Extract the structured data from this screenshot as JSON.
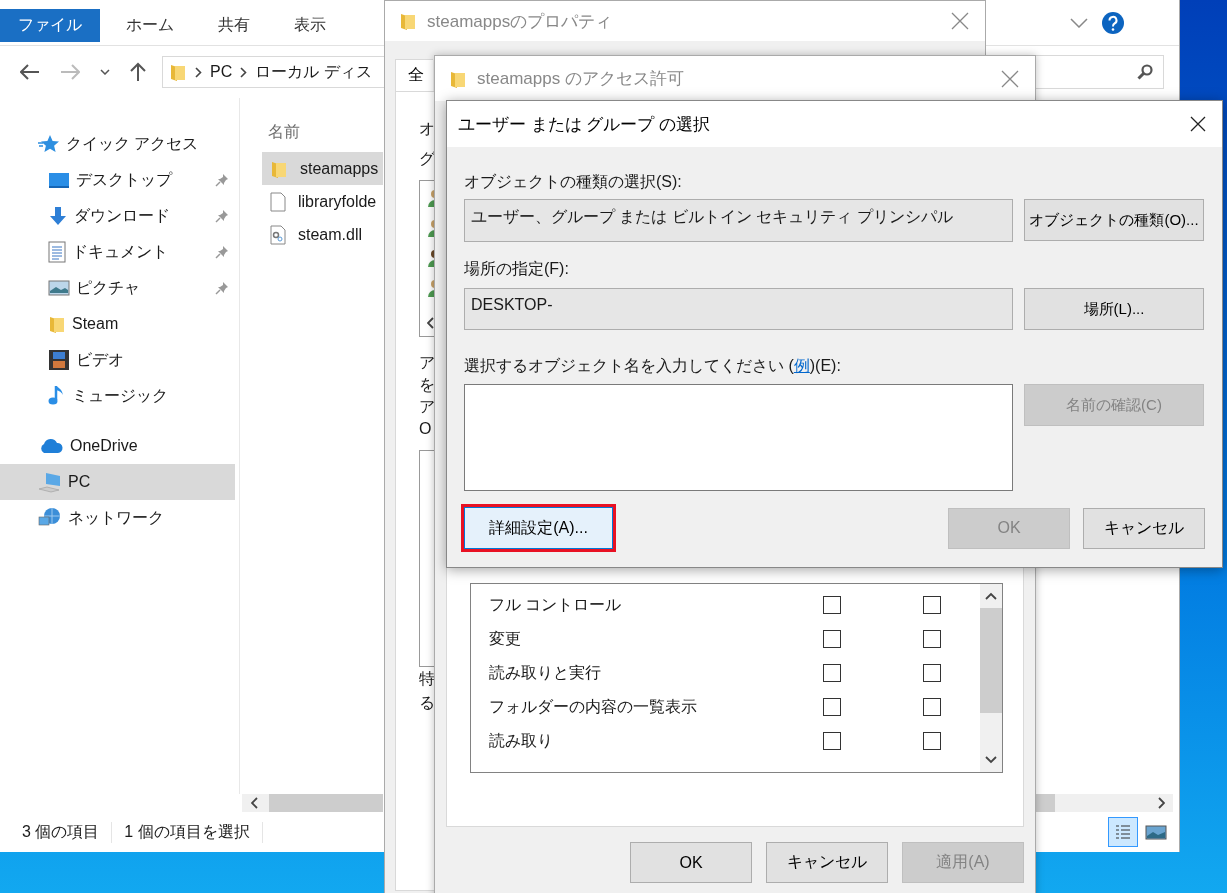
{
  "explorer": {
    "ribbon_tabs": [
      {
        "label": "ファイル",
        "selected": true
      },
      {
        "label": "ホーム",
        "selected": false
      },
      {
        "label": "共有",
        "selected": false
      },
      {
        "label": "表示",
        "selected": false
      }
    ],
    "address": [
      "PC",
      "ローカル ディス"
    ],
    "nav": [
      {
        "label": "クイック アクセス",
        "kind": "star",
        "selected": false,
        "children": [
          {
            "label": "デスクトップ",
            "kind": "desktop",
            "pinned": true,
            "selected": false
          },
          {
            "label": "ダウンロード",
            "kind": "download",
            "pinned": true,
            "selected": false
          },
          {
            "label": "ドキュメント",
            "kind": "document",
            "pinned": true,
            "selected": false
          },
          {
            "label": "ピクチャ",
            "kind": "picture",
            "pinned": true,
            "selected": false
          },
          {
            "label": "Steam",
            "kind": "folder",
            "pinned": false,
            "selected": false
          },
          {
            "label": "ビデオ",
            "kind": "video",
            "pinned": false,
            "selected": false
          },
          {
            "label": "ミュージック",
            "kind": "music",
            "pinned": false,
            "selected": false
          }
        ]
      },
      {
        "label": "OneDrive",
        "kind": "cloud",
        "selected": false
      },
      {
        "label": "PC",
        "kind": "pc",
        "selected": true
      },
      {
        "label": "ネットワーク",
        "kind": "network",
        "selected": false
      }
    ],
    "column_header": "名前",
    "files": [
      {
        "name": "steamapps",
        "kind": "folder",
        "selected": true
      },
      {
        "name": "libraryfolde",
        "kind": "file",
        "selected": false
      },
      {
        "name": "steam.dll",
        "kind": "dll",
        "selected": false
      }
    ],
    "status": [
      "3 個の項目",
      "1 個の項目を選択"
    ]
  },
  "properties_window": {
    "title": "steamappsのプロパティ",
    "tab": "全",
    "lines_top": [
      "オ",
      "グ"
    ],
    "lines_mid": [
      "ア",
      "を",
      "ア",
      "O"
    ],
    "lines_bottom": [
      "特",
      "る"
    ]
  },
  "permissions_window": {
    "title": "steamapps のアクセス許可",
    "permissions": [
      {
        "name": "フル コントロール",
        "allow": false,
        "deny": false
      },
      {
        "name": "変更",
        "allow": false,
        "deny": false
      },
      {
        "name": "読み取りと実行",
        "allow": false,
        "deny": false
      },
      {
        "name": "フォルダーの内容の一覧表示",
        "allow": false,
        "deny": false
      },
      {
        "name": "読み取り",
        "allow": false,
        "deny": false
      }
    ],
    "buttons": [
      {
        "label": "OK",
        "disabled": false
      },
      {
        "label": "キャンセル",
        "disabled": false
      },
      {
        "label": "適用(A)",
        "disabled": true
      }
    ]
  },
  "select_dialog": {
    "title": "ユーザー または グループ の選択",
    "object_types": {
      "label": "オブジェクトの種類の選択(S):",
      "value": "ユーザー、グループ または ビルトイン セキュリティ プリンシパル",
      "button": "オブジェクトの種類(O)..."
    },
    "location": {
      "label": "場所の指定(F):",
      "value": "DESKTOP-",
      "button": "場所(L)..."
    },
    "names": {
      "label_before": "選択するオブジェクト名を入力してください (",
      "link": "例",
      "label_after": ")(E):",
      "check_button": {
        "label": "名前の確認(C)",
        "disabled": true
      }
    },
    "advanced_button": {
      "label": "詳細設定(A)...",
      "highlighted": true
    },
    "buttons": [
      {
        "label": "OK",
        "disabled": true
      },
      {
        "label": "キャンセル",
        "disabled": false
      }
    ]
  }
}
